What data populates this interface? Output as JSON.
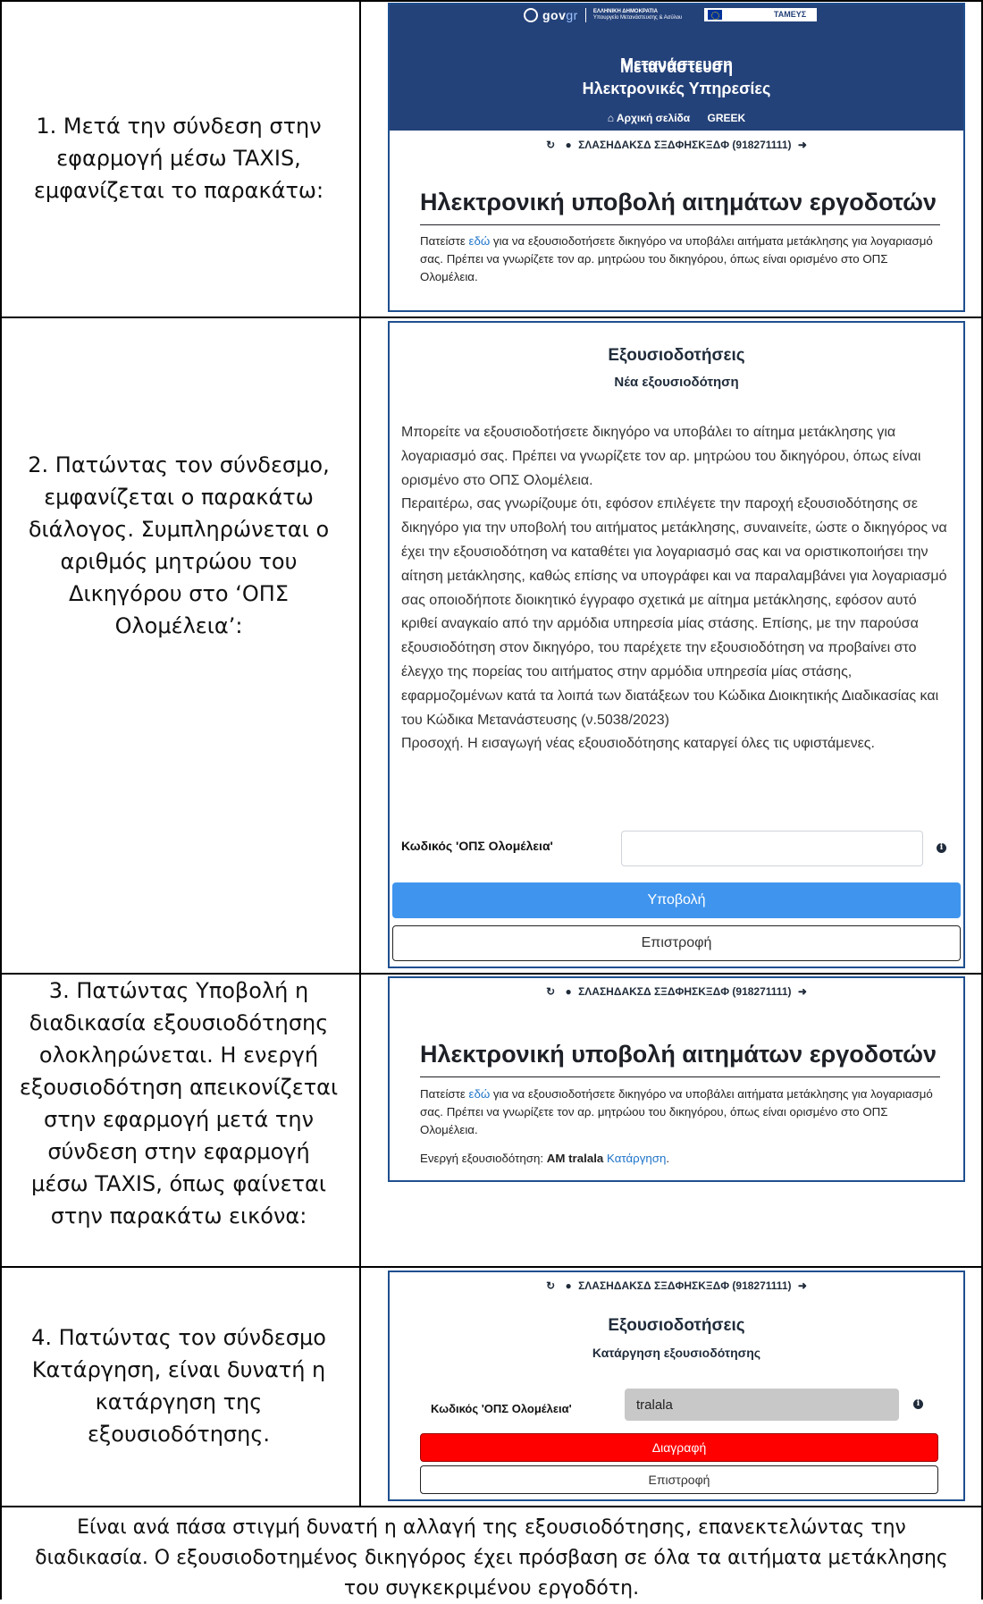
{
  "steps": [
    {
      "text": "1. Μετά την σύνδεση στην εφαρμογή μέσω TAXIS, εμφανίζεται το παρακάτω:"
    },
    {
      "text": "2. Πατώντας τον σύνδεσμο, εμφανίζεται ο παρακάτω διάλογος. Συμπληρώνεται ο αριθμός μητρώου του Δικηγόρου στο ‘ΟΠΣ Ολομέλεια’:"
    },
    {
      "text": "3. Πατώντας Υποβολή η διαδικασία εξουσιοδότησης ολοκληρώνεται. Η ενεργή εξουσιοδότηση απεικονίζεται στην εφαρμογή μετά την σύνδεση στην εφαρμογή μέσω TAXIS, όπως φαίνεται στην παρακάτω εικόνα:"
    },
    {
      "text": "4. Πατώντας τον σύνδεσμο Κατάργηση, είναι δυνατή η κατάργηση της εξουσιοδότησης."
    }
  ],
  "footer": "Είναι ανά πάσα στιγμή δυνατή η αλλαγή της εξουσιοδότησης, επανεκτελώντας την διαδικασία. Ο εξουσιοδοτημένος δικηγόρος έχει πρόσβαση σε όλα τα αιτήματα μετάκλησης του συγκεκριμένου εργοδότη.",
  "header": {
    "gov_logo": "gov",
    "gov_logo_gr": "gr",
    "republic_line1": "ΕΛΛΗΝΙΚΗ ΔΗΜΟΚΡΑΤΙΑ",
    "republic_line2": "Υπουργείο Μετανάστευσης & Ασύλου",
    "tameio_label": "ΤΑΜΕΥΣ",
    "title_line1": "Μετανάστευση",
    "title_line2": "Ηλεκτρονικές Υπηρεσίες",
    "nav_home": "Αρχική σελίδα",
    "nav_language": "GREEK"
  },
  "user_line": "ΣΛΑΣΗΔΑΚΣΔ ΣΞΔΦΗΣΚΞΔΦ (918271111)",
  "main": {
    "heading": "Ηλεκτρονική υποβολή αιτημάτων εργοδοτών",
    "intro_before_link": "Πατείστε ",
    "intro_link": "εδώ",
    "intro_after_link": " για να εξουσιοδοτήσετε δικηγόρο να υποβάλει αιτήματα μετάκλησης για λογαριασμό σας. Πρέπει να γνωρίζετε τον αρ. μητρώου του δικηγόρου, όπως είναι ορισμένο στο ΟΠΣ Ολομέλεια.",
    "active_label": "Ενεργή εξουσιοδότηση: ",
    "active_value": "AM tralala",
    "revoke_link": "Κατάργηση",
    "revoke_period": "."
  },
  "dialog_new": {
    "title": "Εξουσιοδοτήσεις",
    "subtitle": "Νέα εξουσιοδότηση",
    "consent": "Μπορείτε να εξουσιοδοτήσετε δικηγόρο να υποβάλει το αίτημα μετάκλησης για λογαριασμό σας. Πρέπει να γνωρίζετε τον αρ. μητρώου του δικηγόρου, όπως είναι ορισμένο στο ΟΠΣ Ολομέλεια.\nΠεραιτέρω, σας γνωρίζουμε ότι, εφόσον επιλέγετε την παροχή εξουσιοδότησης σε δικηγόρο για την υποβολή του αιτήματος μετάκλησης, συναινείτε, ώστε ο δικηγόρος να έχει την εξουσιοδότηση να καταθέτει για λογαριασμό σας και να οριστικοποιήσει την αίτηση μετάκλησης, καθώς επίσης να υπογράφει και να παραλαμβάνει για λογαριασμό σας οποιοδήποτε διοικητικό έγγραφο σχετικά με αίτημα μετάκλησης, εφόσον αυτό κριθεί αναγκαίο από την αρμόδια υπηρεσία μίας στάσης. Επίσης, με την παρούσα εξουσιοδότηση στον δικηγόρο, του παρέχετε την εξουσιοδότηση να προβαίνει στο έλεγχο της πορείας του αιτήματος στην αρμόδια υπηρεσία μίας στάσης, εφαρμοζομένων κατά τα λοιπά των διατάξεων του Κώδικα Διοικητικής Διαδικασίας και του Κώδικα Μετανάστευσης (ν.5038/2023)\nΠροσοχή. Η εισαγωγή νέας εξουσιοδότησης καταργεί όλες τις υφιστάμενες.",
    "field_label": "Κωδικός 'ΟΠΣ Ολομέλεια'",
    "field_value": "",
    "submit_label": "Υποβολή",
    "back_label": "Επιστροφή"
  },
  "dialog_revoke": {
    "title": "Εξουσιοδοτήσεις",
    "subtitle": "Κατάργηση εξουσιοδότησης",
    "field_label": "Κωδικός 'ΟΠΣ Ολομέλεια'",
    "field_value": "tralala",
    "delete_label": "Διαγραφή",
    "back_label": "Επιστροφή"
  },
  "colors": {
    "header_bg": "#24427a",
    "link": "#1f74c9",
    "primary": "#3f95ee",
    "danger": "#ff0000",
    "panel_border": "#1f4f8f"
  },
  "icons": [
    "refresh-icon",
    "user-icon",
    "logout-icon",
    "home-icon",
    "info-icon"
  ]
}
